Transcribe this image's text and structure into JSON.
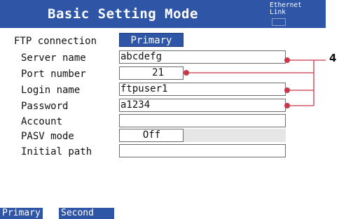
{
  "window": {
    "title": "Basic Setting Mode",
    "status_line1": "Ethernet",
    "status_line2": "Link"
  },
  "ftp": {
    "label": "FTP connection",
    "selected": "Primary"
  },
  "fields": {
    "server_name": {
      "label": "Server name",
      "value": "abcdefg"
    },
    "port_number": {
      "label": "Port number",
      "value": "21"
    },
    "login_name": {
      "label": "Login name",
      "value": "ftpuser1"
    },
    "password": {
      "label": "Password",
      "value": "a1234"
    },
    "account": {
      "label": "Account",
      "value": ""
    },
    "pasv_mode": {
      "label": "PASV mode",
      "value": "Off"
    },
    "initial_path": {
      "label": "Initial path",
      "value": ""
    }
  },
  "softkeys": {
    "primary": "Primary",
    "second": "Second"
  },
  "callout": {
    "number": "4",
    "color": "#c8384a"
  },
  "colors": {
    "accent": "#2f56a6",
    "field_border": "#6d6d6d",
    "pasv_ext": "#e6e6e6"
  }
}
